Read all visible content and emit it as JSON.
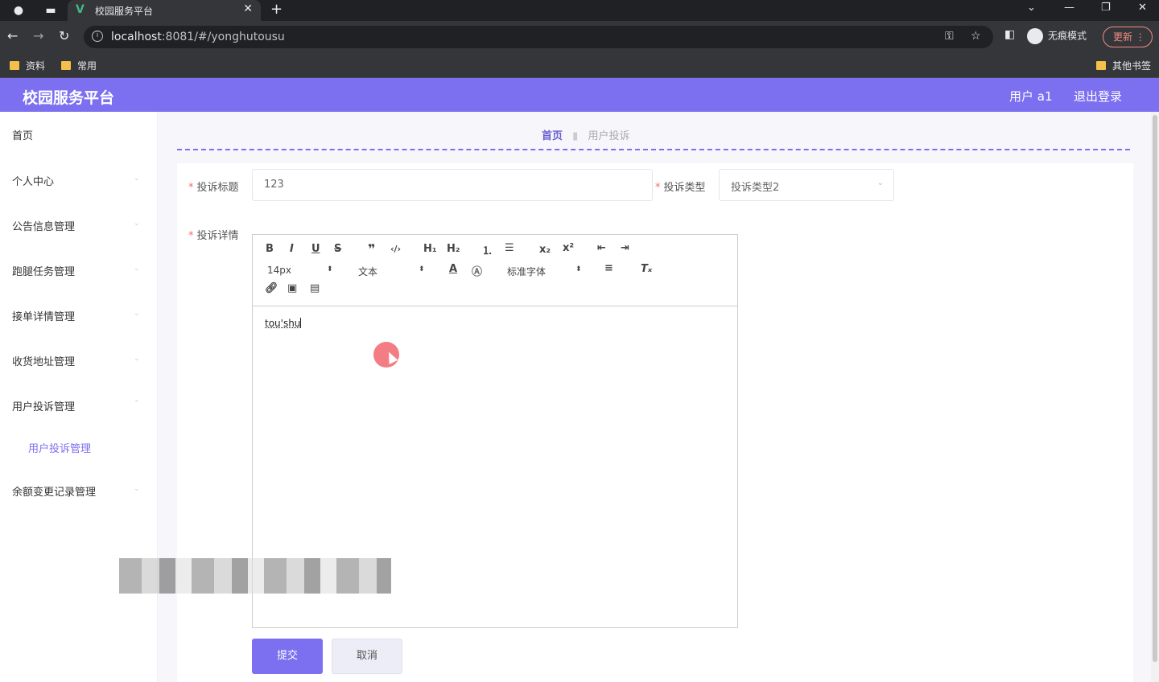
{
  "browser": {
    "tab_title": "校园服务平台",
    "url_host": "localhost",
    "url_rest": ":8081/#/yonghutousu",
    "profile_label": "无痕模式",
    "update_label": "更新",
    "bookmarks": [
      "资料",
      "常用"
    ],
    "other_bookmarks": "其他书签"
  },
  "header": {
    "brand": "校园服务平台",
    "user": "用户 a1",
    "logout": "退出登录"
  },
  "sidebar": {
    "items": [
      "首页",
      "个人中心",
      "公告信息管理",
      "跑腿任务管理",
      "接单详情管理",
      "收货地址管理",
      "用户投诉管理",
      "余额变更记录管理"
    ],
    "sub_item": "用户投诉管理"
  },
  "breadcrumb": {
    "home": "首页",
    "current": "用户投诉"
  },
  "form": {
    "title_label": "投诉标题",
    "title_value": "123",
    "type_label": "投诉类型",
    "type_value": "投诉类型2",
    "detail_label": "投诉详情",
    "editor": {
      "font_size": "14px",
      "text_style": "文本",
      "font_family": "标准字体",
      "content": "tou'shu"
    },
    "submit_label": "提交",
    "cancel_label": "取消"
  },
  "colors": {
    "accent": "#7c6ff0",
    "required": "#f56c6c"
  }
}
